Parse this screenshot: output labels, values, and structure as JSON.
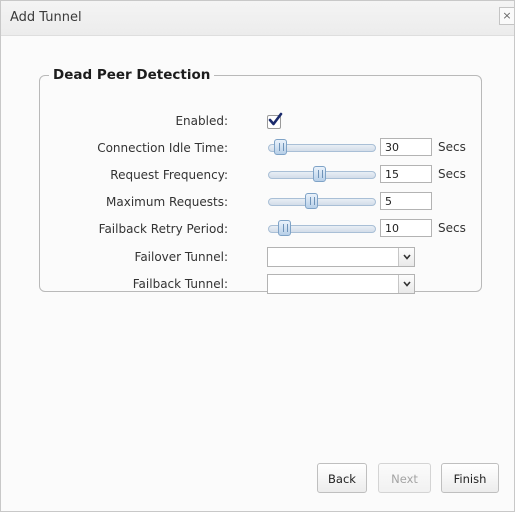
{
  "dialog": {
    "title": "Add Tunnel",
    "close_label": "×"
  },
  "section": {
    "legend": "Dead Peer Detection"
  },
  "fields": {
    "enabled": {
      "label": "Enabled:",
      "checked": true
    },
    "idle_time": {
      "label": "Connection Idle Time:",
      "value": "30",
      "unit": "Secs",
      "slider_fraction": 0.05
    },
    "request_frequency": {
      "label": "Request Frequency:",
      "value": "15",
      "unit": "Secs",
      "slider_fraction": 0.47
    },
    "maximum_requests": {
      "label": "Maximum Requests:",
      "value": "5",
      "unit": "",
      "slider_fraction": 0.39
    },
    "failback_retry": {
      "label": "Failback Retry Period:",
      "value": "10",
      "unit": "Secs",
      "slider_fraction": 0.1
    },
    "failover_tunnel": {
      "label": "Failover Tunnel:",
      "value": ""
    },
    "failback_tunnel": {
      "label": "Failback Tunnel:",
      "value": ""
    }
  },
  "buttons": {
    "back": "Back",
    "next": "Next",
    "finish": "Finish"
  }
}
